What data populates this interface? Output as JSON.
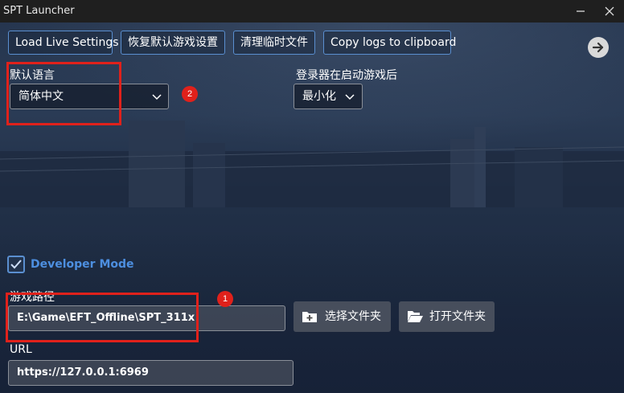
{
  "window": {
    "title": "SPT Launcher"
  },
  "toolbar": {
    "load_live": "Load Live Settings",
    "restore_defaults": "恢复默认游戏设置",
    "clear_temp": "清理临时文件",
    "copy_logs": "Copy logs to clipboard"
  },
  "language": {
    "label": "默认语言",
    "value": "简体中文"
  },
  "launcher_action": {
    "label": "登录器在启动游戏后",
    "value": "最小化"
  },
  "developer_mode": {
    "label": "Developer Mode",
    "checked": true
  },
  "game_path": {
    "label": "游戏路径",
    "value": "E:\\Game\\EFT_Offline\\SPT_311x",
    "select_folder": "选择文件夹",
    "open_folder": "打开文件夹"
  },
  "url": {
    "label": "URL",
    "value": "https://127.0.0.1:6969"
  },
  "annotations": {
    "badge1": "1",
    "badge2": "2"
  },
  "colors": {
    "accent": "#4d8fe0",
    "annotation": "#e0211b"
  }
}
